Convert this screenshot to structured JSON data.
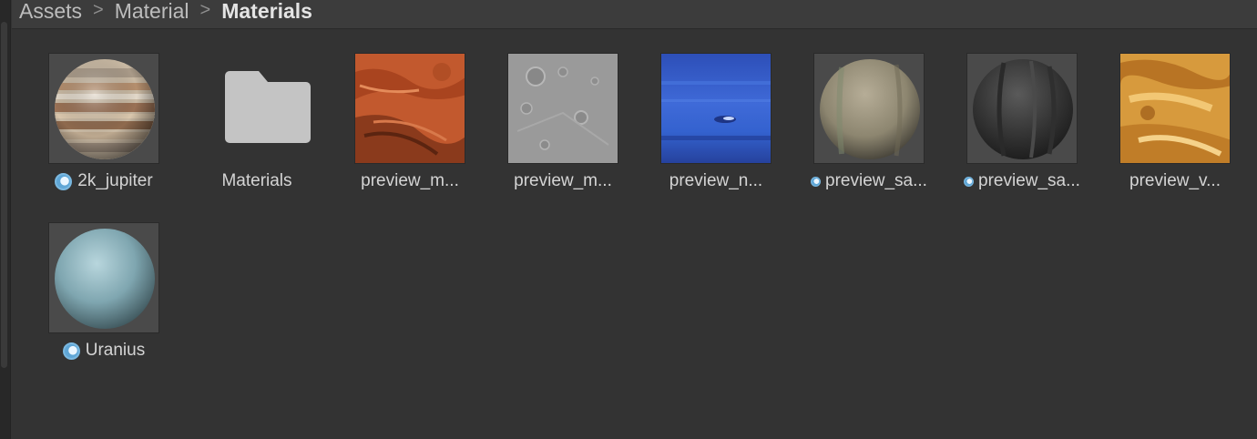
{
  "breadcrumb": {
    "items": [
      "Assets",
      "Material",
      "Materials"
    ],
    "separator": ">"
  },
  "assets": [
    {
      "label": "2k_jupiter",
      "kind": "material",
      "icon": "material-icon"
    },
    {
      "label": "Materials",
      "kind": "folder",
      "icon": "folder-icon"
    },
    {
      "label": "preview_m...",
      "kind": "texture"
    },
    {
      "label": "preview_m...",
      "kind": "texture"
    },
    {
      "label": "preview_n...",
      "kind": "texture"
    },
    {
      "label": "preview_sa...",
      "kind": "material",
      "icon": "material-icon"
    },
    {
      "label": "preview_sa...",
      "kind": "material",
      "icon": "material-icon"
    },
    {
      "label": "preview_v...",
      "kind": "texture"
    },
    {
      "label": "Uranius",
      "kind": "material",
      "icon": "material-icon"
    }
  ],
  "colors": {
    "background": "#333333",
    "breadcrumb_bar": "#3c3c3c",
    "material_icon": "#7ab8e0",
    "folder": "#c4c4c4"
  }
}
